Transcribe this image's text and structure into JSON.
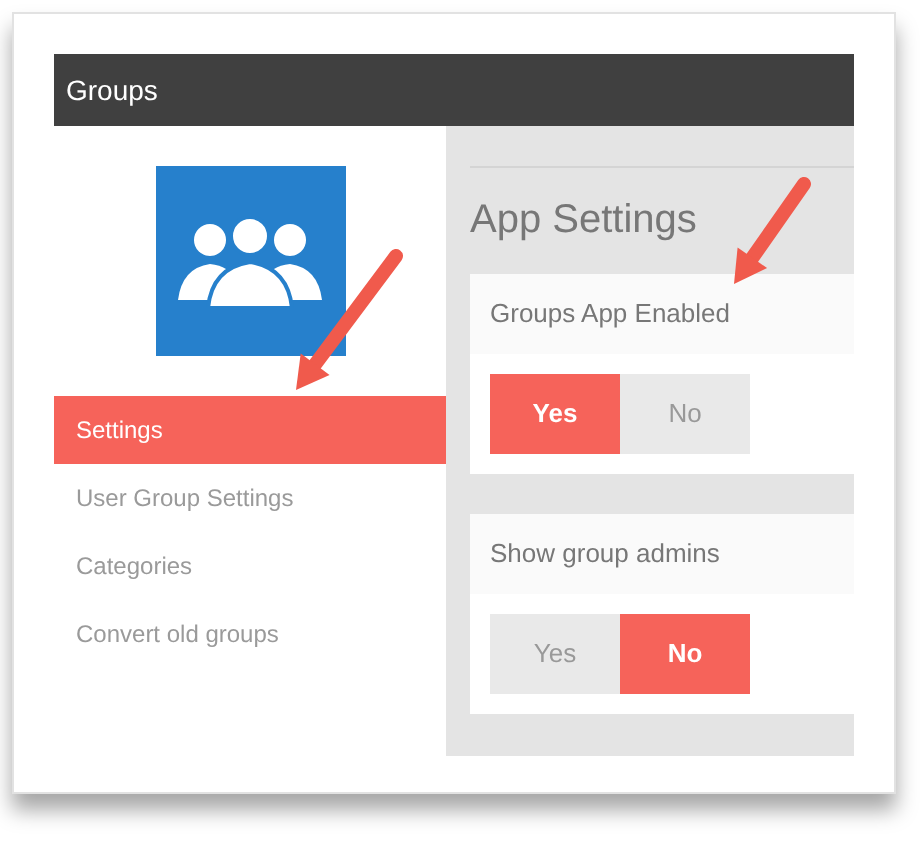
{
  "window": {
    "title": "Groups"
  },
  "sidebar": {
    "items": [
      {
        "label": "Settings",
        "selected": true
      },
      {
        "label": "User Group Settings",
        "selected": false
      },
      {
        "label": "Categories",
        "selected": false
      },
      {
        "label": "Convert old groups",
        "selected": false
      }
    ]
  },
  "main": {
    "heading": "App Settings",
    "settings": [
      {
        "label": "Groups App Enabled",
        "options": [
          {
            "label": "Yes",
            "selected": true
          },
          {
            "label": "No",
            "selected": false
          }
        ]
      },
      {
        "label": "Show group admins",
        "options": [
          {
            "label": "Yes",
            "selected": false
          },
          {
            "label": "No",
            "selected": true
          }
        ]
      }
    ]
  }
}
